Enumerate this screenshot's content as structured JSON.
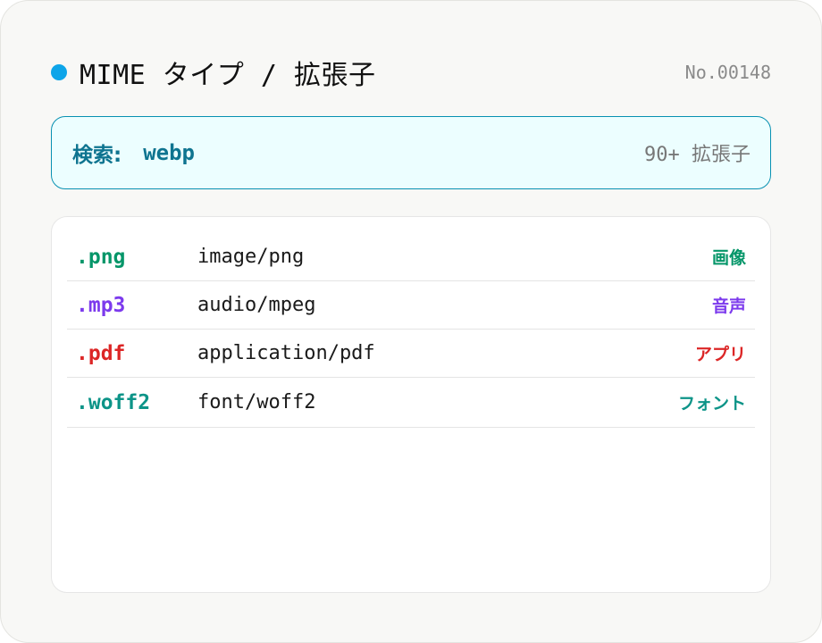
{
  "header": {
    "title": "MIME タイプ / 拡張子",
    "code": "No.00148",
    "dot_color": "#0ea5e9"
  },
  "search": {
    "label": "検索:",
    "value": "webp",
    "count": "90+ 拡張子"
  },
  "rows": [
    {
      "ext": ".png",
      "mime": "image/png",
      "category": "画像",
      "color": "#059669"
    },
    {
      "ext": ".mp3",
      "mime": "audio/mpeg",
      "category": "音声",
      "color": "#7c3aed"
    },
    {
      "ext": ".pdf",
      "mime": "application/pdf",
      "category": "アプリ",
      "color": "#dc2626"
    },
    {
      "ext": ".woff2",
      "mime": "font/woff2",
      "category": "フォント",
      "color": "#0d9488"
    }
  ]
}
